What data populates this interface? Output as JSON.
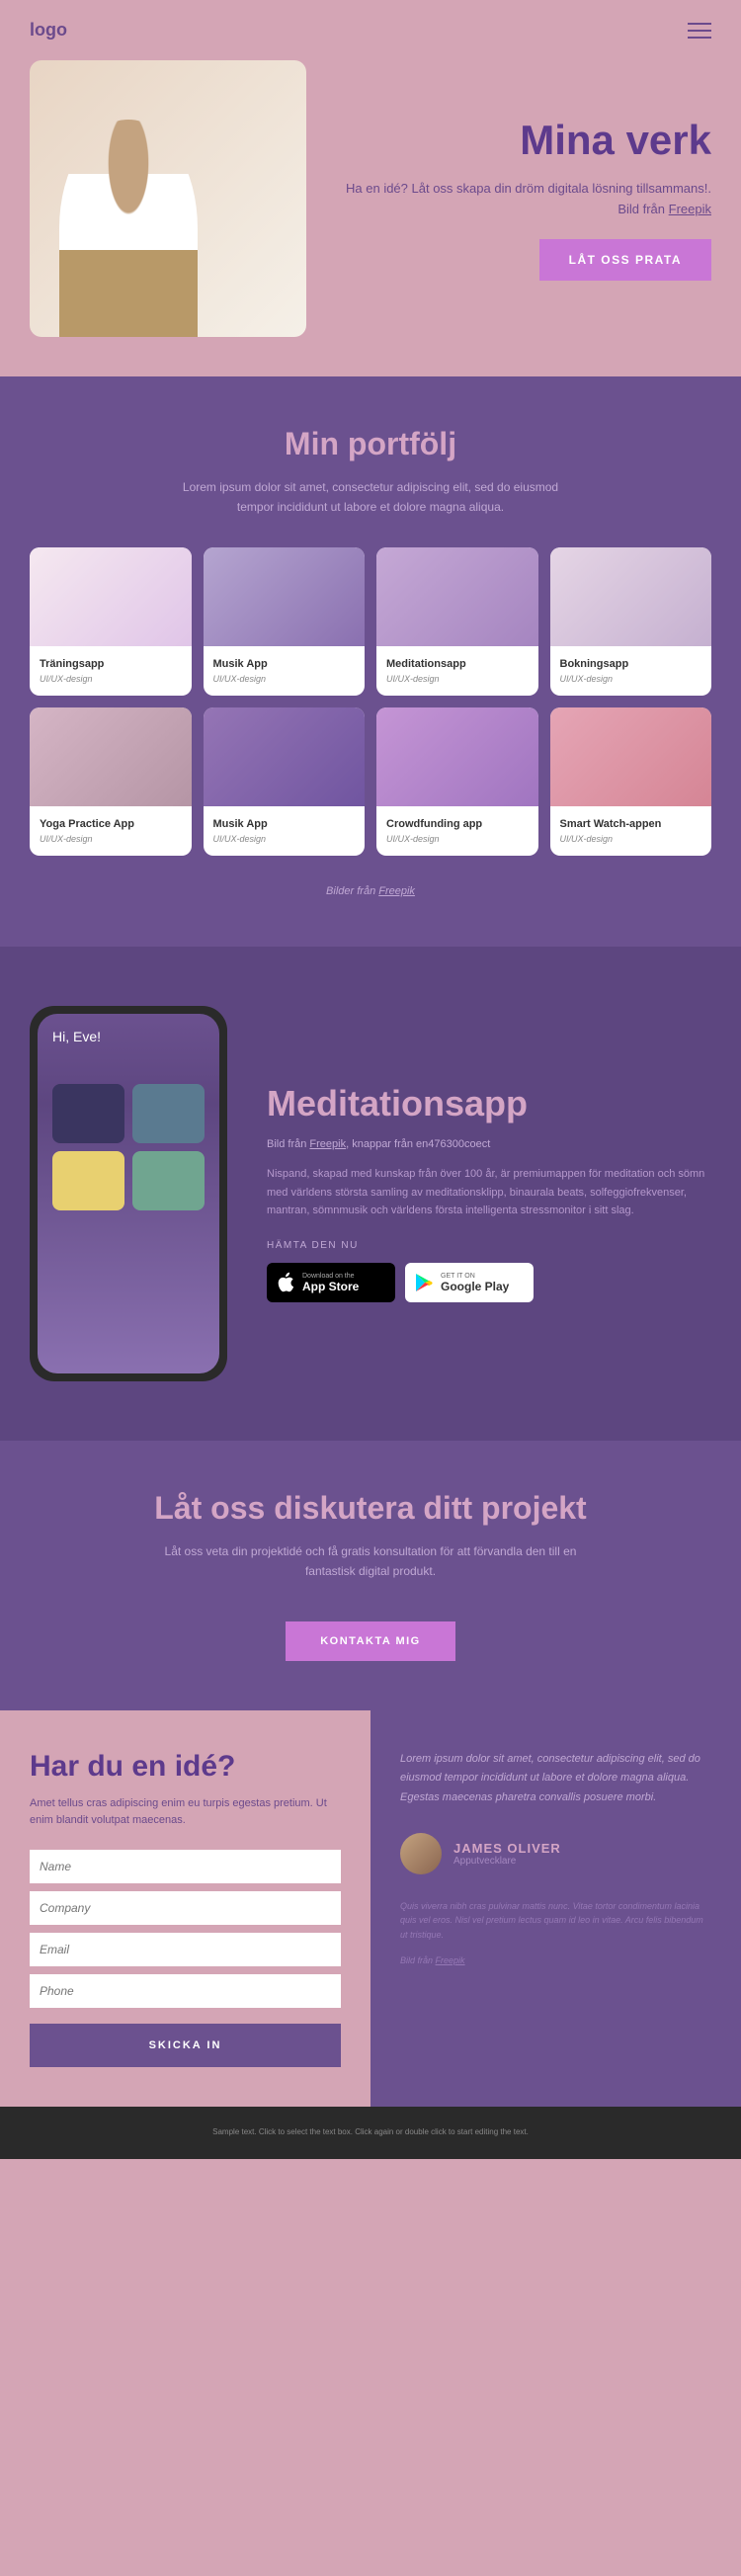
{
  "header": {
    "logo": "logo"
  },
  "hero": {
    "title": "Mina verk",
    "desc_pre": "Ha en idé? Låt oss skapa din dröm digitala lösning tillsammans!. Bild från ",
    "desc_link": "Freepik",
    "cta": "LÅT OSS PRATA"
  },
  "portfolio": {
    "heading": "Min portfölj",
    "desc": "Lorem ipsum dolor sit amet, consectetur adipiscing elit, sed do eiusmod tempor incididunt ut labore et dolore magna aliqua.",
    "items": [
      {
        "title": "Träningsapp",
        "sub": "UI/UX-design"
      },
      {
        "title": "Musik App",
        "sub": "UI/UX-design"
      },
      {
        "title": "Meditationsapp",
        "sub": "UI/UX-design"
      },
      {
        "title": "Bokningsapp",
        "sub": "UI/UX-design"
      },
      {
        "title": "Yoga Practice App",
        "sub": "UI/UX-design"
      },
      {
        "title": "Musik App",
        "sub": "UI/UX-design"
      },
      {
        "title": "Crowdfunding app",
        "sub": "UI/UX-design"
      },
      {
        "title": "Smart Watch-appen",
        "sub": "UI/UX-design"
      }
    ],
    "credit_pre": "Bilder från ",
    "credit_link": "Freepik"
  },
  "app": {
    "phone_hello": "Hi, Eve!",
    "title": "Meditationsapp",
    "meta_pre": "Bild från ",
    "meta_link1": "Freepik",
    "meta_mid": ", knappar från ",
    "meta_link2": "en476300coect",
    "desc": "Nispand, skapad med kunskap från över 100 år, är premiumappen för meditation och sömn med världens största samling av meditationsklipp, binaurala beats, solfeggiofrekvenser, mantran, sömnmusik och världens första intelligenta stressmonitor i sitt slag.",
    "download": "HÄMTA DEN NU",
    "appstore_small": "Download on the",
    "appstore_big": "App Store",
    "google_small": "GET IT ON",
    "google_big": "Google Play"
  },
  "discuss": {
    "title": "Låt oss diskutera ditt projekt",
    "desc": "Låt oss veta din projektidé och få gratis konsultation för att förvandla den till en fantastisk digital produkt.",
    "cta": "KONTAKTA MIG"
  },
  "form": {
    "title": "Har du en idé?",
    "desc": "Amet tellus cras adipiscing enim eu turpis egestas pretium. Ut enim blandit volutpat maecenas.",
    "ph_name": "Name",
    "ph_company": "Company",
    "ph_email": "Email",
    "ph_phone": "Phone",
    "submit": "SKICKA IN"
  },
  "quote": {
    "text": "Lorem ipsum dolor sit amet, consectetur adipiscing elit, sed do eiusmod tempor incididunt ut labore et dolore magna aliqua. Egestas maecenas pharetra convallis posuere morbi.",
    "author": "JAMES OLIVER",
    "role": "Apputvecklare",
    "footer1": "Quis viverra nibh cras pulvinar mattis nunc. Vitae tortor condimentum lacinia quis vel eros. Nisl vel pretium lectus quam id leo in vitae. Arcu felis bibendum ut tristique.",
    "footer2_pre": "Bild från ",
    "footer2_link": "Freepik"
  },
  "footer": {
    "text": "Sample text. Click to select the text box. Click again or double click to start editing the text."
  }
}
